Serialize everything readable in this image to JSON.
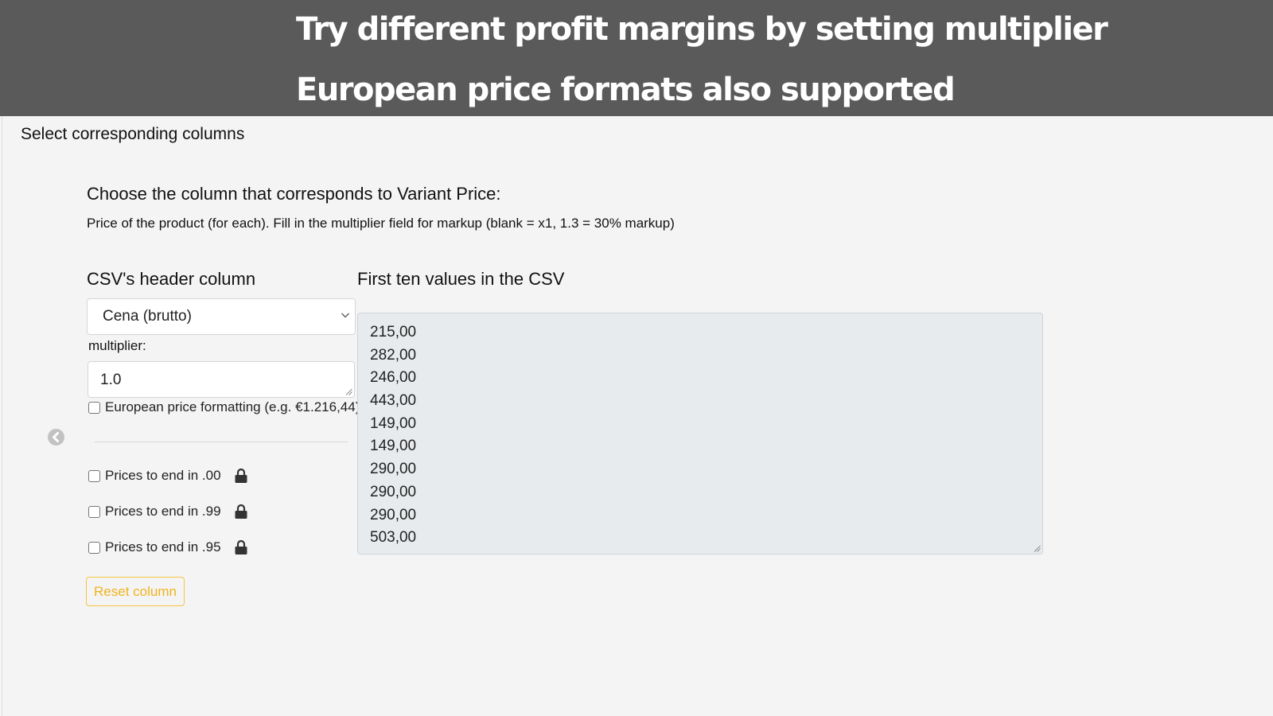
{
  "banner": {
    "line1": "Try different profit margins by setting multiplier",
    "line2": "European price formats also supported"
  },
  "section_title": "Select corresponding columns",
  "field": {
    "heading": "Choose the column that corresponds to Variant Price:",
    "description": "Price of the product (for each). Fill in the multiplier field for markup (blank = x1, 1.3 = 30% markup)"
  },
  "columns": {
    "left_heading": "CSV's header column",
    "right_heading": "First ten values in the CSV"
  },
  "header_select": {
    "selected": "Cena (brutto)"
  },
  "multiplier": {
    "label": "multiplier:",
    "value": "1.0"
  },
  "options": {
    "european_format": {
      "label": "European price formatting (e.g. €1.216,44)",
      "checked": false
    },
    "rounding": [
      {
        "label": "Prices to end in .00",
        "checked": false,
        "locked": true
      },
      {
        "label": "Prices to end in .99",
        "checked": false,
        "locked": true
      },
      {
        "label": "Prices to end in .95",
        "checked": false,
        "locked": true
      }
    ]
  },
  "reset_button": "Reset column",
  "csv_values": [
    "215,00",
    "282,00",
    "246,00",
    "443,00",
    "149,00",
    "149,00",
    "290,00",
    "290,00",
    "290,00",
    "503,00"
  ],
  "colors": {
    "banner_bg": "#5a5a5a",
    "page_bg": "#f4f4f4",
    "accent_warning": "#f0b41c",
    "values_bg": "#e8ebee"
  },
  "icons": {
    "back": "chevron-left-circle-icon",
    "lock": "lock-icon",
    "select": "chevron-down-icon"
  }
}
